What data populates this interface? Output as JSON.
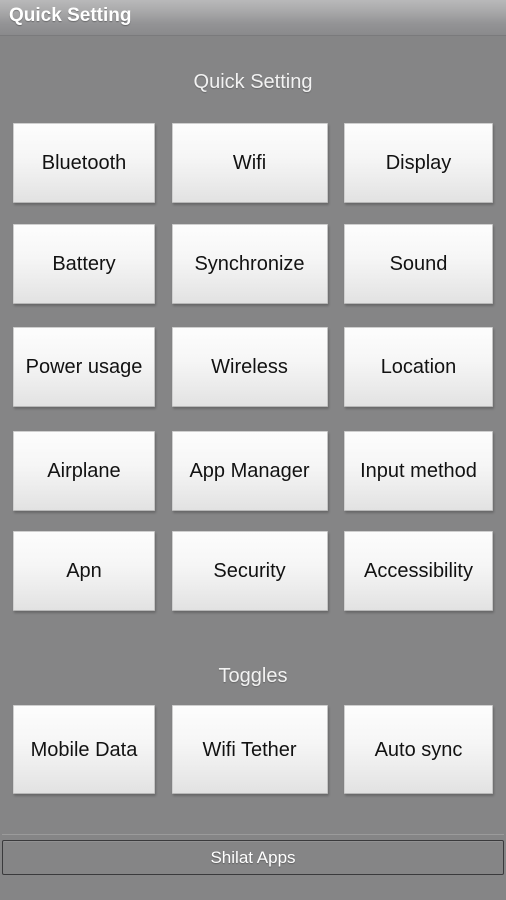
{
  "window": {
    "title": "Quick Setting"
  },
  "sections": [
    {
      "id": "quick-setting",
      "header": "Quick Setting",
      "rows": [
        [
          {
            "label": "Bluetooth",
            "name": "bluetooth"
          },
          {
            "label": "Wifi",
            "name": "wifi"
          },
          {
            "label": "Display",
            "name": "display"
          }
        ],
        [
          {
            "label": "Battery",
            "name": "battery"
          },
          {
            "label": "Synchronize",
            "name": "synchronize"
          },
          {
            "label": "Sound",
            "name": "sound"
          }
        ],
        [
          {
            "label": "Power usage",
            "name": "power-usage"
          },
          {
            "label": "Wireless",
            "name": "wireless"
          },
          {
            "label": "Location",
            "name": "location"
          }
        ],
        [
          {
            "label": "Airplane",
            "name": "airplane"
          },
          {
            "label": "App Manager",
            "name": "app-manager"
          },
          {
            "label": "Input method",
            "name": "input-method"
          }
        ],
        [
          {
            "label": "Apn",
            "name": "apn"
          },
          {
            "label": "Security",
            "name": "security"
          },
          {
            "label": "Accessibility",
            "name": "accessibility"
          }
        ]
      ]
    },
    {
      "id": "toggles",
      "header": "Toggles",
      "rows": [
        [
          {
            "label": "Mobile Data",
            "name": "mobile-data"
          },
          {
            "label": "Wifi Tether",
            "name": "wifi-tether"
          },
          {
            "label": "Auto sync",
            "name": "auto-sync"
          }
        ]
      ]
    }
  ],
  "footer": {
    "label": "Shilat Apps"
  },
  "colors": {
    "background": "#858586",
    "titlebar_top": "#b9b9ba",
    "titlebar_bottom": "#8a8a8c",
    "button_face": "#f4f4f4",
    "button_text": "#121212",
    "header_text": "#f2f2f2",
    "footer_border": "#3a3a3c"
  }
}
